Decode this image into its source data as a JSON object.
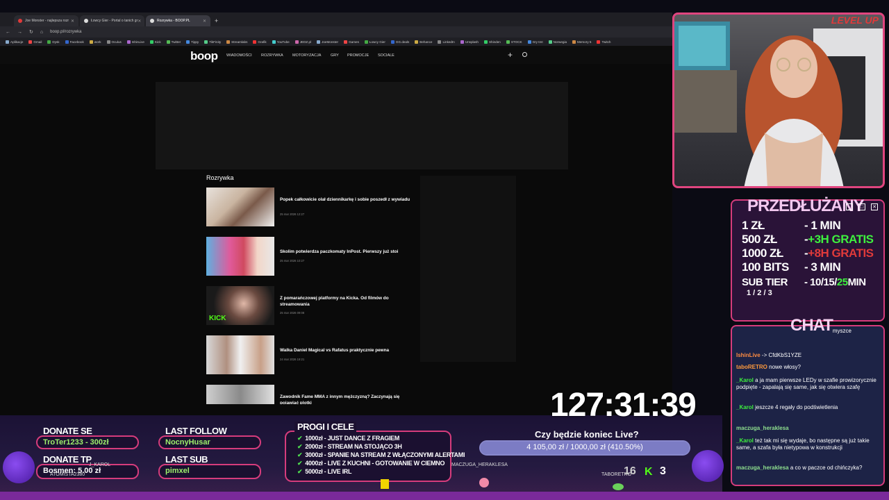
{
  "browser": {
    "tabs": [
      {
        "label": "Joe Monster - najlepsza rozr",
        "color": "#e03a3a",
        "active": false
      },
      {
        "label": "Łowcy Gier - Portal o tanich gr",
        "color": "#dddddd",
        "active": false
      },
      {
        "label": "Rozrywka - BOOP.PL",
        "color": "#dddddd",
        "active": true
      }
    ],
    "new_tab": "+",
    "url": "boop.pl/rozrywka",
    "bookmarks": [
      "Aplikacje",
      "Gmail",
      "Dysk",
      "Facebook",
      "work",
      "Oculus",
      "IshinLive",
      "Kick",
      "Twitter",
      "Tippy",
      "TikFinity",
      "Streamlabs",
      "Grafik",
      "YouTube",
      "JEDZ.pl",
      "JoeMonster",
      "Games",
      "Łowcy Gier",
      "GG.deals",
      "Behance",
      "LinkedIn",
      "Unsplash",
      "Shinden",
      "STOCK",
      "Gry tmt",
      "Norwegia",
      "Memory 5",
      "Twitch"
    ]
  },
  "site": {
    "logo": "boop",
    "nav": [
      "WIADOMOŚCI",
      "ROZRYWKA",
      "MOTORYZACJA",
      "GRY",
      "PROMOCJE",
      "SOCIALE"
    ],
    "plus": "+",
    "search_icon": "search-icon",
    "section_title": "Rozrywka",
    "articles": [
      {
        "title": "Popek całkowicie olał dziennikarkę i sobie poszedł z wywiadu",
        "date": "25 mar 2026 12:27"
      },
      {
        "title": "Skolim potwierdza paczkomaty InPost. Pierwszy już stoi",
        "date": "25 mar 2026 10:27"
      },
      {
        "title": "Z pomarańczowej platformy na Kicka. Od filmów do streamowania",
        "date": "25 mar 2026 09:08",
        "thumb_tag": "KICK"
      },
      {
        "title": "Walka Daniel Magical vs Rafatus praktycznie pewna",
        "date": "24 mar 2026 19:21"
      },
      {
        "title": "Zawodnik Fame MMA z innym mężczyzną? Zaczynają się pojawiać plotki",
        "date": ""
      }
    ]
  },
  "overlay": {
    "timer": "127:31:39",
    "przedluzany": {
      "title": "PRZEDŁUŻANY",
      "rows": [
        {
          "k": "1 ZŁ",
          "v": "- 1 MIN",
          "extra": ""
        },
        {
          "k": "500 ZŁ",
          "v": "- ",
          "extra": "+3H GRATIS",
          "extra_color": "#3ef03e"
        },
        {
          "k": "1000 ZŁ",
          "v": "- ",
          "extra": "+8H GRATIS",
          "extra_color": "#e03a3a"
        },
        {
          "k": "100 BITS",
          "v": "- 3 MIN",
          "extra": ""
        },
        {
          "k": "SUB TIER",
          "v": "- 10/15/",
          "extra": "25",
          "extra_color": "#3ef03e",
          "tail": " MIN"
        }
      ],
      "tier_line": "1 / 2 / 3",
      "minimize": "_",
      "maximize": "□",
      "close": "✕"
    },
    "chat": {
      "title": "CHAT",
      "messages": [
        {
          "name": "",
          "text": "myszce",
          "color": "#ffffff"
        },
        {
          "name": "IshinLive",
          "text": "-> CfdKbS1YZE",
          "color": "#ff8c42"
        },
        {
          "name": "taboRETRO",
          "text": "nowe włosy?",
          "color": "#ff9a3c"
        },
        {
          "name": "_Karol",
          "text": "a ja mam pierwsze LEDy w szafie prowizorycznie podpięte - zapalają się same, jak się otwiera szafę",
          "color": "#3ef03e"
        },
        {
          "name": "_Karol",
          "text": "jeszcze 4 regały do podświetlenia",
          "color": "#3ef03e"
        },
        {
          "name": "maczuga_heraklesa",
          "text": "",
          "color": "#8fe08f"
        },
        {
          "name": "_Karol",
          "text": "też tak mi się wydaje, bo następne są już takie same, a szafa była nietypowa w konstrukcji",
          "color": "#3ef03e"
        },
        {
          "name": "maczuga_heraklesa",
          "text": "a co w paczce od chińczyka?",
          "color": "#8fe08f"
        }
      ]
    },
    "donate_se": {
      "label": "DONATE SE",
      "value": "TroTer1233 - 300zł"
    },
    "donate_tp": {
      "label": "DONATE TP",
      "value": "Bosmen: 5.00 zł"
    },
    "last_follow": {
      "label": "LAST FOLLOW",
      "value": "NocnyHusar"
    },
    "last_sub": {
      "label": "LAST SUB",
      "value": "pimxel"
    },
    "progi": {
      "title": "PROGI I CELE",
      "items": [
        "1000zł - JUST DANCE Z FRAGIEM",
        "2000zł - STREAM NA STOJĄCO 3H",
        "3000zł - SPANIE NA STREAM Z WŁĄCZONYMI ALERTAMI",
        "4000zł - LIVE Z KUCHNI - GOTOWANIE W CIEMNO",
        "5000zł - LIVE IRL"
      ]
    },
    "goal": {
      "question": "Czy będzie koniec Live?",
      "text": "4 105,00 zł / 1000,00 zł (410.50%)",
      "progress_pct": 100
    },
    "game_names": [
      "J_KAROL",
      "ATOMISTA2380",
      "MACZUGA_HERAKLESA",
      "TABORETRO"
    ],
    "score_a": "16",
    "score_b": "3",
    "brand_logo": "LEVEL UP"
  }
}
